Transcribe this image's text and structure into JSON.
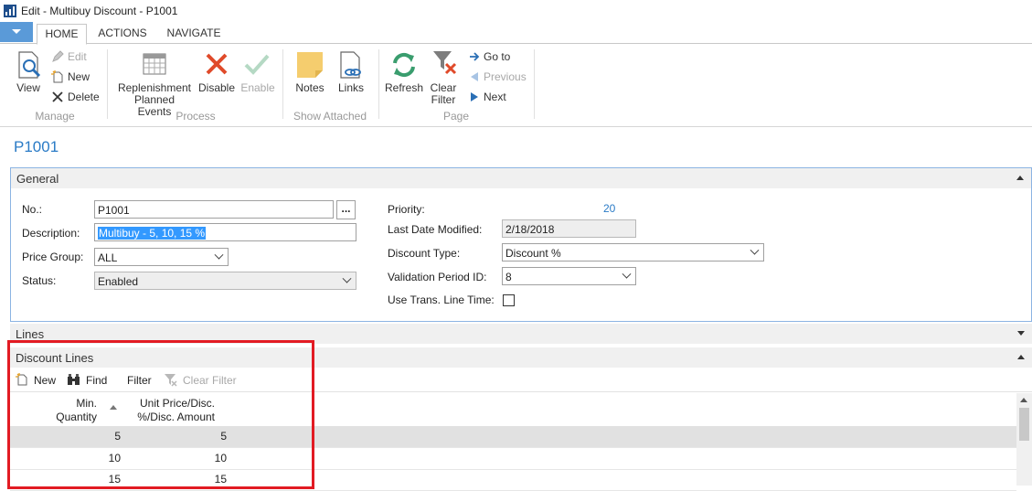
{
  "window": {
    "title": "Edit - Multibuy Discount - P1001"
  },
  "ribbon_tabs": [
    {
      "label": "HOME"
    },
    {
      "label": "ACTIONS"
    },
    {
      "label": "NAVIGATE"
    }
  ],
  "ribbon": {
    "manage": {
      "group_label": "Manage",
      "view": "View",
      "edit": "Edit",
      "new": "New",
      "delete": "Delete"
    },
    "process": {
      "group_label": "Process",
      "replenishment_line1": "Replenishment",
      "replenishment_line2": "Planned Events",
      "disable": "Disable",
      "enable": "Enable"
    },
    "show_attached": {
      "group_label": "Show Attached",
      "notes": "Notes",
      "links": "Links"
    },
    "page": {
      "group_label": "Page",
      "refresh": "Refresh",
      "clear_filter_line1": "Clear",
      "clear_filter_line2": "Filter",
      "goto": "Go to",
      "previous": "Previous",
      "next": "Next"
    }
  },
  "page_title": "P1001",
  "general": {
    "header": "General",
    "no_label": "No.:",
    "no_value": "P1001",
    "ellipsis": "...",
    "description_label": "Description:",
    "description_value": "Multibuy - 5, 10, 15 %",
    "price_group_label": "Price Group:",
    "price_group_value": "ALL",
    "status_label": "Status:",
    "status_value": "Enabled",
    "priority_label": "Priority:",
    "priority_value": "20",
    "last_modified_label": "Last Date Modified:",
    "last_modified_value": "2/18/2018",
    "discount_type_label": "Discount Type:",
    "discount_type_value": "Discount %",
    "validation_period_label": "Validation Period ID:",
    "validation_period_value": "8",
    "trans_line_time_label": "Use Trans. Line Time:"
  },
  "lines": {
    "header": "Lines"
  },
  "discount_lines": {
    "header": "Discount Lines",
    "toolbar": {
      "new": "New",
      "find": "Find",
      "filter": "Filter",
      "clear_filter": "Clear Filter"
    },
    "columns": {
      "min_qty_line1": "Min.",
      "min_qty_line2": "Quantity",
      "price_line1": "Unit Price/Disc.",
      "price_line2": "%/Disc. Amount"
    },
    "rows": [
      {
        "min_qty": "5",
        "value": "5"
      },
      {
        "min_qty": "10",
        "value": "10"
      },
      {
        "min_qty": "15",
        "value": "15"
      }
    ]
  },
  "colors": {
    "accent": "#2a7bc6",
    "highlight_box": "#e21b23",
    "app_menu": "#5a9ad8"
  }
}
